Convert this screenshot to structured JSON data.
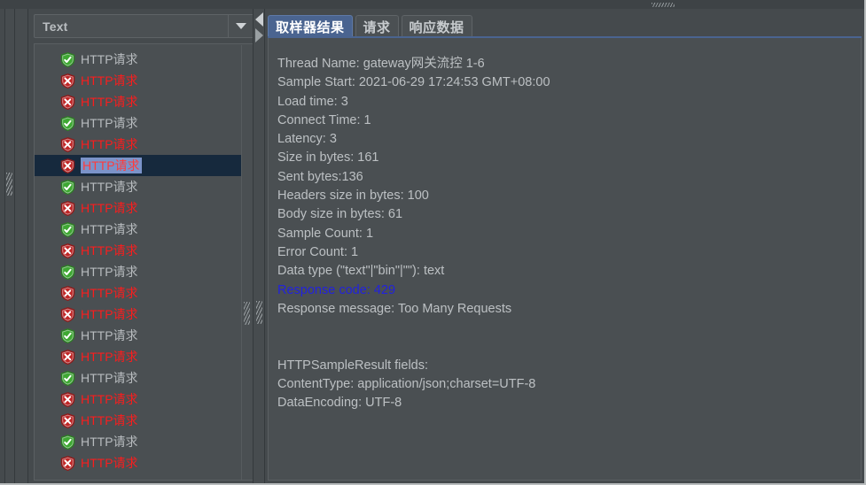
{
  "window": {
    "background_color": "#454a4d",
    "panel_color": "#4a4f52"
  },
  "splitters": {
    "top_horizontal_grip": "grip-handle",
    "left_vertical_grip": "grip-handle",
    "panel_vertical_grip": "grip-handle",
    "collapse_left_icon": "triangle-left-icon",
    "collapse_right_icon": "triangle-right-icon"
  },
  "tree_panel": {
    "combo": {
      "selected_value": "Text",
      "arrow_icon": "chevron-down-icon"
    },
    "scrollbar": {
      "grip": "scroll-grip"
    },
    "rows": [
      {
        "label": "HTTP请求",
        "status": "ok",
        "selected": false
      },
      {
        "label": "HTTP请求",
        "status": "error",
        "selected": false
      },
      {
        "label": "HTTP请求",
        "status": "error",
        "selected": false
      },
      {
        "label": "HTTP请求",
        "status": "ok",
        "selected": false
      },
      {
        "label": "HTTP请求",
        "status": "error",
        "selected": false
      },
      {
        "label": "HTTP请求",
        "status": "error",
        "selected": true
      },
      {
        "label": "HTTP请求",
        "status": "ok",
        "selected": false
      },
      {
        "label": "HTTP请求",
        "status": "error",
        "selected": false
      },
      {
        "label": "HTTP请求",
        "status": "ok",
        "selected": false
      },
      {
        "label": "HTTP请求",
        "status": "error",
        "selected": false
      },
      {
        "label": "HTTP请求",
        "status": "ok",
        "selected": false
      },
      {
        "label": "HTTP请求",
        "status": "error",
        "selected": false
      },
      {
        "label": "HTTP请求",
        "status": "error",
        "selected": false
      },
      {
        "label": "HTTP请求",
        "status": "ok",
        "selected": false
      },
      {
        "label": "HTTP请求",
        "status": "error",
        "selected": false
      },
      {
        "label": "HTTP请求",
        "status": "ok",
        "selected": false
      },
      {
        "label": "HTTP请求",
        "status": "error",
        "selected": false
      },
      {
        "label": "HTTP请求",
        "status": "error",
        "selected": false
      },
      {
        "label": "HTTP请求",
        "status": "ok",
        "selected": false
      },
      {
        "label": "HTTP请求",
        "status": "error",
        "selected": false
      }
    ],
    "status_icons": {
      "ok": "shield-check-icon",
      "error": "shield-error-icon"
    },
    "colors": {
      "ok_text": "#b7bbbe",
      "error_text": "#fb1d1d",
      "selected_row_bg": "#16293d",
      "selected_text_bg": "#7b93c9",
      "selected_text": "#ff3b3b",
      "ok_icon": "#3aa82e",
      "error_icon": "#c12222"
    }
  },
  "result_panel": {
    "tabs": [
      {
        "label": "取样器结果",
        "active": true
      },
      {
        "label": "请求",
        "active": false
      },
      {
        "label": "响应数据",
        "active": false
      }
    ],
    "active_tab_color": "#4a6490",
    "lines": [
      {
        "text": "Thread Name: gateway网关流控 1-6",
        "style": "normal"
      },
      {
        "text": "Sample Start: 2021-06-29 17:24:53 GMT+08:00",
        "style": "normal"
      },
      {
        "text": "Load time: 3",
        "style": "normal"
      },
      {
        "text": "Connect Time: 1",
        "style": "normal"
      },
      {
        "text": "Latency: 3",
        "style": "normal"
      },
      {
        "text": "Size in bytes: 161",
        "style": "normal"
      },
      {
        "text": "Sent bytes:136",
        "style": "normal"
      },
      {
        "text": "Headers size in bytes: 100",
        "style": "normal"
      },
      {
        "text": "Body size in bytes: 61",
        "style": "normal"
      },
      {
        "text": "Sample Count: 1",
        "style": "normal"
      },
      {
        "text": "Error Count: 1",
        "style": "normal"
      },
      {
        "text": "Data type (\"text\"|\"bin\"|\"\"): text",
        "style": "normal"
      },
      {
        "text": "Response code: 429",
        "style": "highlight"
      },
      {
        "text": "Response message: Too Many Requests",
        "style": "normal"
      },
      {
        "text": "",
        "style": "blank"
      },
      {
        "text": "",
        "style": "blank"
      },
      {
        "text": "HTTPSampleResult fields:",
        "style": "normal"
      },
      {
        "text": "ContentType: application/json;charset=UTF-8",
        "style": "normal"
      },
      {
        "text": "DataEncoding: UTF-8",
        "style": "normal"
      }
    ],
    "highlight_color": "#2222dd",
    "text_color": "#bcc0c3"
  }
}
